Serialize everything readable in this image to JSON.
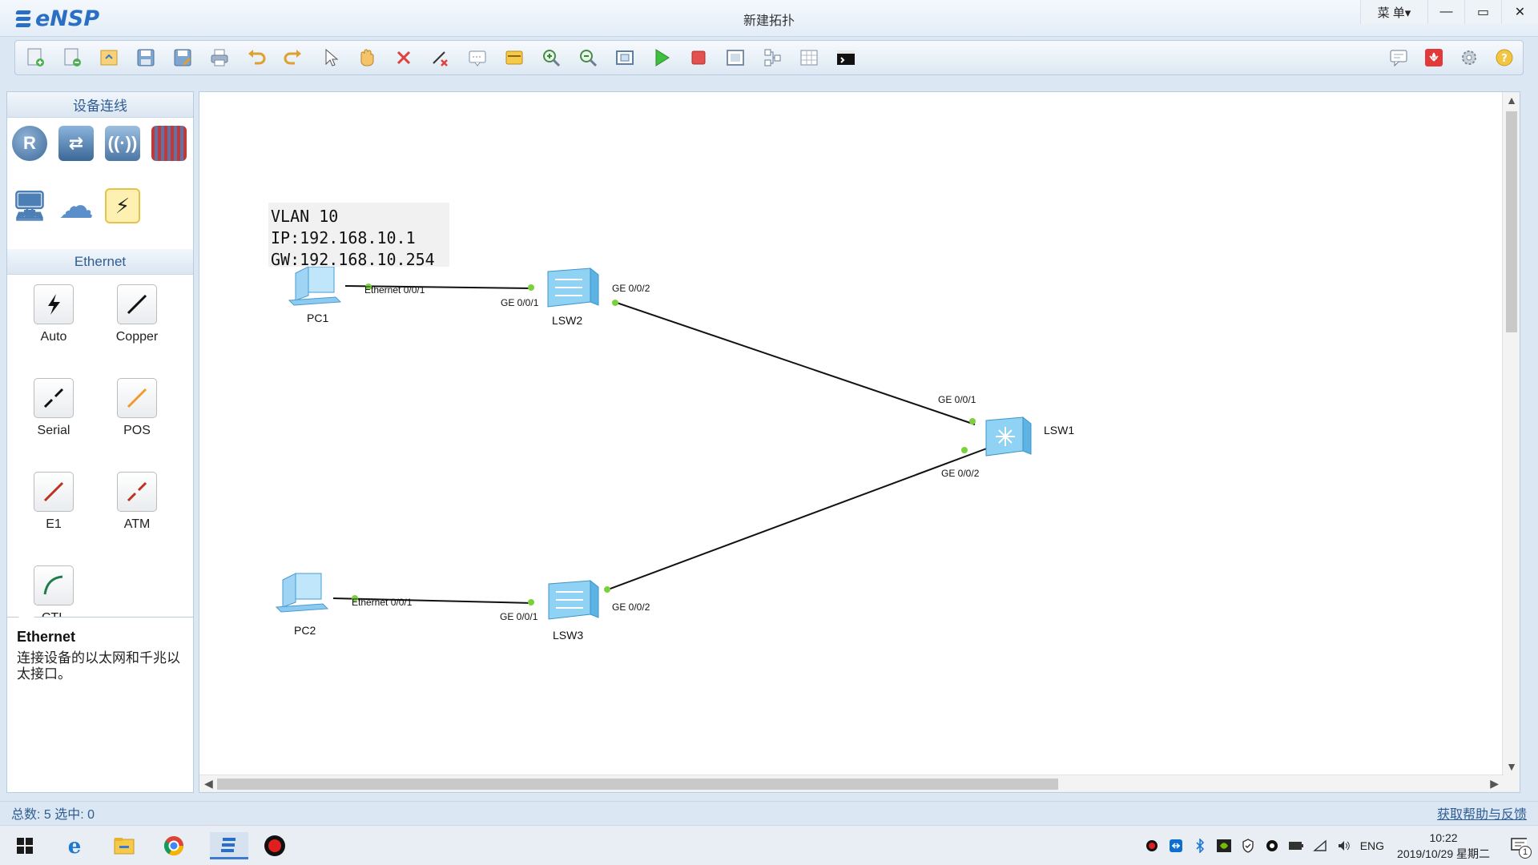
{
  "app": {
    "logo": "eNSP",
    "window_title": "新建拓扑",
    "menu_label": "菜 单▾",
    "minimize": "—",
    "restore": "▭",
    "close": "✕"
  },
  "toolbar": {
    "icons": [
      "new-topology",
      "new-exam",
      "open",
      "save",
      "save-as",
      "print",
      "undo",
      "redo",
      "select",
      "pan",
      "delete",
      "delete-links",
      "text",
      "palette",
      "zoom-in",
      "zoom-out",
      "fit",
      "start",
      "stop",
      "capture",
      "topology",
      "grid",
      "console"
    ],
    "right_icons": [
      "feedback",
      "huawei",
      "settings",
      "help"
    ]
  },
  "left_panel": {
    "devices_header": "设备连线",
    "cables_header": "Ethernet",
    "cables": [
      {
        "label": "Auto",
        "color": "#111111",
        "kind": "lightning"
      },
      {
        "label": "Copper",
        "color": "#111111",
        "kind": "line"
      },
      {
        "label": "Serial",
        "color": "#111111",
        "kind": "dashline"
      },
      {
        "label": "POS",
        "color": "#f29a2e",
        "kind": "line"
      },
      {
        "label": "E1",
        "color": "#c0301e",
        "kind": "line"
      },
      {
        "label": "ATM",
        "color": "#c0301e",
        "kind": "dashline"
      },
      {
        "label": "CTL",
        "color": "#1f7d4a",
        "kind": "curve"
      }
    ],
    "description": {
      "title": "Ethernet",
      "text": "连接设备的以太网和千兆以太接口。"
    }
  },
  "canvas": {
    "note": {
      "line1": "VLAN 10",
      "line2": "IP:192.168.10.1",
      "line3": "GW:192.168.10.254"
    },
    "devices": {
      "pc1": "PC1",
      "pc2": "PC2",
      "lsw1": "LSW1",
      "lsw2": "LSW2",
      "lsw3": "LSW3"
    },
    "ports": {
      "pc1_eth": "Ethernet 0/0/1",
      "lsw2_ge1": "GE 0/0/1",
      "lsw2_ge2": "GE 0/0/2",
      "lsw1_ge1": "GE 0/0/1",
      "lsw1_ge2": "GE 0/0/2",
      "lsw3_ge2": "GE 0/0/2",
      "lsw3_ge1": "GE 0/0/1",
      "pc2_eth": "Ethernet 0/0/1"
    },
    "link_color": "#111111",
    "port_up_color": "#7bd13b"
  },
  "status": {
    "counts": "总数: 5 选中: 0",
    "help": "获取帮助与反馈"
  },
  "taskbar": {
    "language": "ENG",
    "time": "10:22",
    "date": "2019/10/29 星期二",
    "notification_count": "1"
  }
}
